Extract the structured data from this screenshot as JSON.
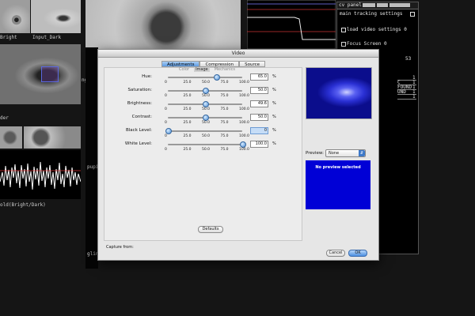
{
  "background": {
    "thumb_labels": [
      "Bright",
      "Input_Dark",
      "ngDa",
      "der",
      "old(Bright/Dark)",
      "pupil",
      "glint"
    ],
    "cv_panel": {
      "title": "cv panel",
      "header_buttons": [
        "",
        "",
        ""
      ],
      "lines": [
        "main tracking settings",
        "load video settings 0",
        "Focus Screen 0",
        "53"
      ],
      "table_rows": [
        [
          "",
          "1"
        ],
        [
          "C",
          "1"
        ],
        [
          "FOUND",
          "1"
        ],
        [
          "UND",
          "1"
        ],
        [
          "",
          "1"
        ]
      ]
    }
  },
  "dialog": {
    "title": "Video",
    "tabs": [
      "Adjustments",
      "Compression",
      "Source"
    ],
    "active_tab": 0,
    "subtabs": [
      "Color",
      "Image",
      "Mechanics"
    ],
    "active_subtab": 1,
    "sliders": [
      {
        "label": "Hue:",
        "value": "65.0",
        "unit": "%",
        "level": 0.65,
        "focused": false
      },
      {
        "label": "Saturation:",
        "value": "50.0",
        "unit": "%",
        "level": 0.5,
        "focused": false
      },
      {
        "label": "Brightness:",
        "value": "49.6",
        "unit": "%",
        "level": 0.496,
        "focused": false
      },
      {
        "label": "Contrast:",
        "value": "50.0",
        "unit": "%",
        "level": 0.5,
        "focused": false
      },
      {
        "label": "Black Level:",
        "value": "0",
        "unit": "%",
        "level": 0.0,
        "focused": true
      },
      {
        "label": "White Level:",
        "value": "100.0",
        "unit": "%",
        "level": 1.0,
        "focused": false
      }
    ],
    "tick_labels": [
      "0",
      "25.0",
      "50.0",
      "75.0",
      "100.0"
    ],
    "defaults_label": "Defaults",
    "preview_label": "Preview:",
    "preview_option": "None",
    "no_preview_text": "No preview selected",
    "capture_from": "Capture from:",
    "cancel_label": "Cancel",
    "ok_label": "OK"
  },
  "colors": {
    "accent": "#5e9ce4",
    "preview_blue": "#0000d6"
  }
}
